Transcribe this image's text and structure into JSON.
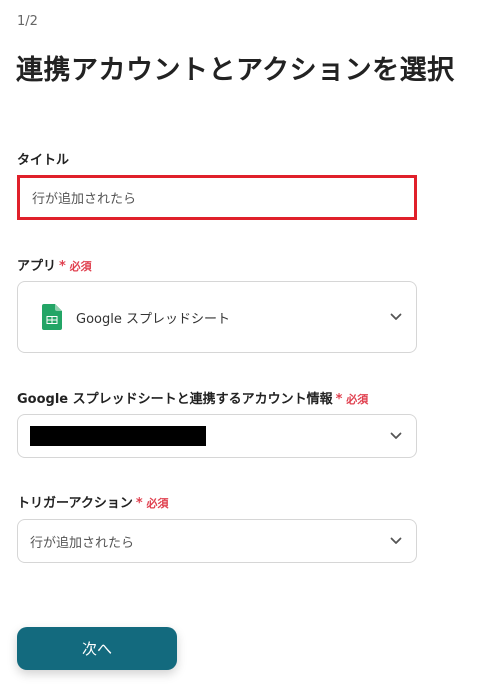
{
  "header": {
    "step": "1/2",
    "title": "連携アカウントとアクションを選択"
  },
  "form": {
    "title_field": {
      "label": "タイトル",
      "value": "行が追加されたら"
    },
    "app_field": {
      "label": "アプリ",
      "required_mark": "*",
      "required_text": "必須",
      "selected_app": "Google スプレッドシート",
      "icon": "google-sheets-icon"
    },
    "account_field": {
      "label": "Google スプレッドシートと連携するアカウント情報",
      "required_mark": "*",
      "required_text": "必須",
      "value_redacted": true
    },
    "trigger_field": {
      "label": "トリガーアクション",
      "required_mark": "*",
      "required_text": "必須",
      "value": "行が追加されたら"
    }
  },
  "actions": {
    "next_label": "次へ"
  },
  "colors": {
    "highlight_border": "#e0202a",
    "required": "#e0404f",
    "button": "#136a7e",
    "sheets_green": "#23a566"
  }
}
